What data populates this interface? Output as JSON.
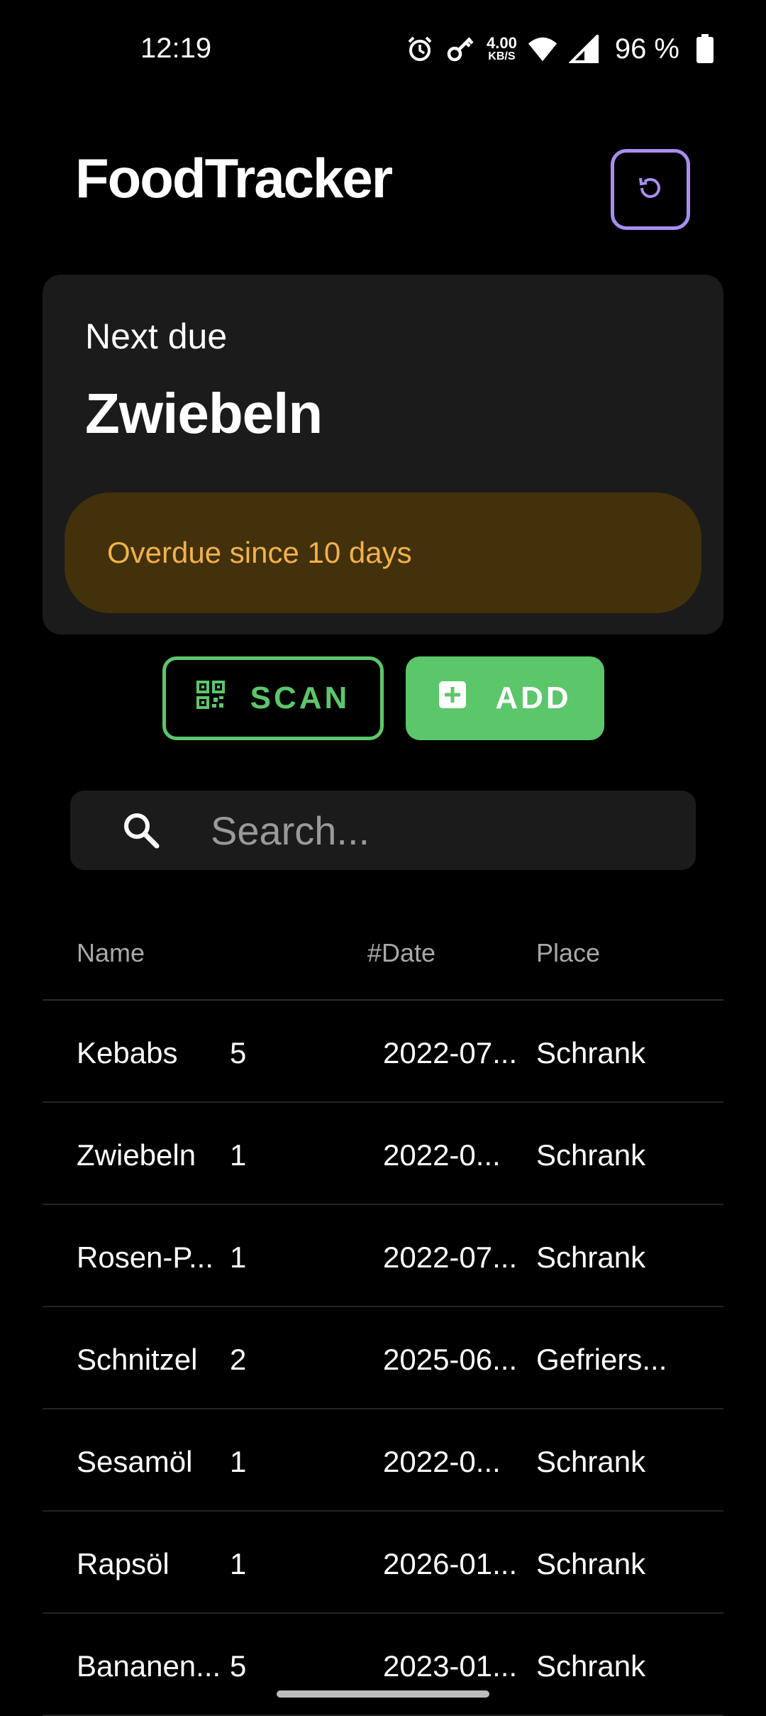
{
  "status_bar": {
    "time": "12:19",
    "speed_value": "4.00",
    "speed_unit": "KB/S",
    "battery": "96 %"
  },
  "header": {
    "title": "FoodTracker"
  },
  "next_due": {
    "label": "Next due",
    "name": "Zwiebeln",
    "status": "Overdue since 10 days"
  },
  "actions": {
    "scan_label": "SCAN",
    "add_label": "ADD"
  },
  "search": {
    "placeholder": "Search..."
  },
  "table": {
    "headers": {
      "name": "Name",
      "date": "#Date",
      "place": "Place"
    },
    "rows": [
      {
        "name": "Kebabs",
        "qty": "5",
        "date": "2022-07...",
        "place": "Schrank"
      },
      {
        "name": "Zwiebeln",
        "qty": "1",
        "date": "2022-0...",
        "place": "Schrank"
      },
      {
        "name": "Rosen-P...",
        "qty": "1",
        "date": "2022-07...",
        "place": "Schrank"
      },
      {
        "name": "Schnitzel",
        "qty": "2",
        "date": "2025-06...",
        "place": "Gefriers..."
      },
      {
        "name": "Sesamöl",
        "qty": "1",
        "date": "2022-0...",
        "place": "Schrank"
      },
      {
        "name": "Rapsöl",
        "qty": "1",
        "date": "2026-01...",
        "place": "Schrank"
      },
      {
        "name": "Bananen...",
        "qty": "5",
        "date": "2023-01...",
        "place": "Schrank"
      }
    ]
  },
  "colors": {
    "accent_purple": "#a98ef0",
    "accent_green": "#5cc66a",
    "overdue_bg": "#43310b",
    "overdue_text": "#f0b24a"
  },
  "icons": {
    "refresh": "refresh-icon",
    "scan": "qr-code-icon",
    "add": "plus-box-icon",
    "search": "search-icon"
  }
}
